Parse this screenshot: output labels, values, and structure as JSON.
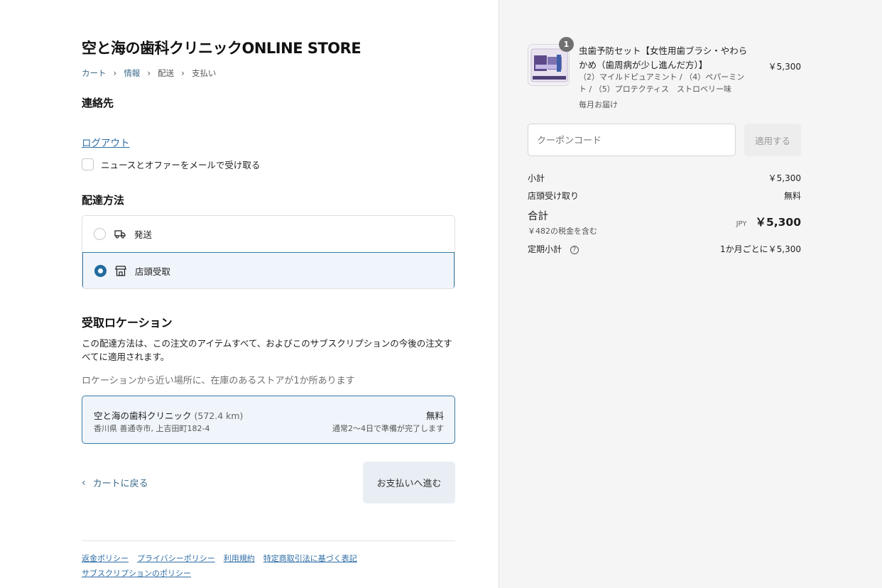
{
  "store": {
    "title": "空と海の歯科クリニックONLINE STORE"
  },
  "breadcrumb": [
    {
      "label": "カート"
    },
    {
      "label": "情報"
    },
    {
      "label": "配送"
    },
    {
      "label": "支払い"
    }
  ],
  "contact": {
    "heading": "連絡先",
    "logout_label": "ログアウト",
    "newsletter_label": "ニュースとオファーをメールで受け取る"
  },
  "delivery": {
    "heading": "配達方法",
    "options": [
      {
        "label": "発送",
        "icon": "truck-icon",
        "selected": false
      },
      {
        "label": "店頭受取",
        "icon": "store-icon",
        "selected": true
      }
    ]
  },
  "pickup": {
    "heading": "受取ロケーション",
    "description": "この配達方法は、この注文のアイテムすべて、およびこのサブスクリプションの今後の注文すべてに適用されます。",
    "note": "ロケーションから近い場所に、在庫のあるストアが1か所あります",
    "location": {
      "name": "空と海の歯科クリニック",
      "distance": "(572.4 km)",
      "address": "香川県 善通寺市, 上吉田町182-4",
      "price": "無料",
      "ready": "通常2～4日で準備が完了します"
    }
  },
  "nav": {
    "back_label": "カートに戻る",
    "continue_label": "お支払いへ進む"
  },
  "footer": {
    "links": [
      "返金ポリシー",
      "プライバシーポリシー",
      "利用規約",
      "特定商取引法に基づく表記",
      "サブスクリプションのポリシー"
    ]
  },
  "cart": {
    "item": {
      "quantity": "1",
      "name": "虫歯予防セット【女性用歯ブラシ・やわらかめ（歯周病が少し進んだ方）】",
      "variant": "（2）マイルドピュアミント / （4）ペパーミント / （5）プロテクティス　ストロベリー味",
      "frequency": "毎月お届け",
      "price": "￥5,300"
    },
    "coupon_placeholder": "クーポンコード",
    "apply_label": "適用する",
    "subtotal_label": "小計",
    "subtotal_value": "￥5,300",
    "pickup_label": "店頭受け取り",
    "pickup_value": "無料",
    "total_label": "合計",
    "tax_note": "￥482の税金を含む",
    "currency": "JPY",
    "total_value": "￥5,300",
    "recurring_label": "定期小計",
    "recurring_value": "1か月ごとに￥5,300"
  },
  "colors": {
    "accent": "#236b9e",
    "link": "#2f6ea5",
    "selected_bg": "#f0f5fb"
  }
}
